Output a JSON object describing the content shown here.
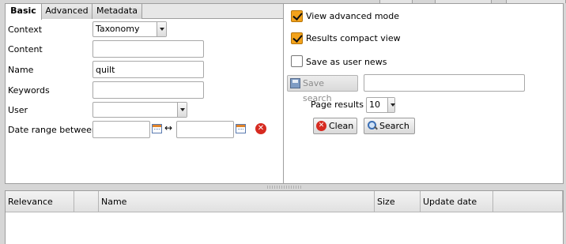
{
  "tabs": [
    {
      "label": "Basic",
      "active": true
    },
    {
      "label": "Advanced",
      "active": false
    },
    {
      "label": "Metadata",
      "active": false
    }
  ],
  "form": {
    "context_label": "Context",
    "context_value": "Taxonomy",
    "content_label": "Content",
    "content_value": "",
    "name_label": "Name",
    "name_value": "quilt",
    "keywords_label": "Keywords",
    "keywords_value": "",
    "user_label": "User",
    "user_value": "",
    "date_range_label": "Date range between",
    "date_from": "",
    "date_to": "",
    "range_arrow": "↔"
  },
  "options": {
    "view_advanced_label": "View advanced mode",
    "view_advanced_checked": true,
    "compact_label": "Results compact view",
    "compact_checked": true,
    "user_news_label": "Save as user news",
    "user_news_checked": false,
    "save_search_label": "Save search",
    "save_search_value": "",
    "page_results_label": "Page results",
    "page_results_value": "10",
    "clean_label": "Clean",
    "search_label": "Search"
  },
  "results": {
    "columns": [
      "Relevance",
      "",
      "Name",
      "Size",
      "Update date",
      ""
    ]
  },
  "colors": {
    "accent_checkbox": "#f3a21a",
    "clear_icon": "#d62a20"
  },
  "icons": {
    "calendar": "calendar-icon",
    "clear": "clear-date-icon",
    "save": "disk-icon",
    "clean": "clean-icon",
    "search": "magnifier-icon"
  }
}
